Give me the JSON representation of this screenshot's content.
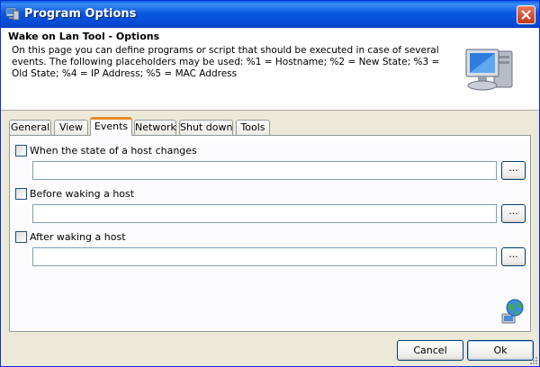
{
  "window": {
    "title": "Program Options",
    "close_tooltip": "Close"
  },
  "header": {
    "title": "Wake on Lan Tool - Options",
    "description": "On this page you can define programs or script that should be executed in case of several events. The following placeholders may be used: %1 = Hostname; %2 = New State; %3 = Old State; %4 = IP Address; %5 = MAC Address"
  },
  "tabs": [
    {
      "label": "General",
      "active": false
    },
    {
      "label": "View",
      "active": false
    },
    {
      "label": "Events",
      "active": true
    },
    {
      "label": "Network",
      "active": false
    },
    {
      "label": "Shut down",
      "active": false
    },
    {
      "label": "Tools",
      "active": false
    }
  ],
  "events": [
    {
      "label": "When the state of a host changes",
      "checked": false,
      "value": "",
      "browse_label": "..."
    },
    {
      "label": "Before waking a host",
      "checked": false,
      "value": "",
      "browse_label": "..."
    },
    {
      "label": "After waking a host",
      "checked": false,
      "value": "",
      "browse_label": "..."
    }
  ],
  "buttons": {
    "cancel": "Cancel",
    "ok": "Ok"
  },
  "icons": {
    "app": "app-window-icon",
    "monitor": "computer-monitor-icon",
    "globe": "globe-network-icon"
  }
}
